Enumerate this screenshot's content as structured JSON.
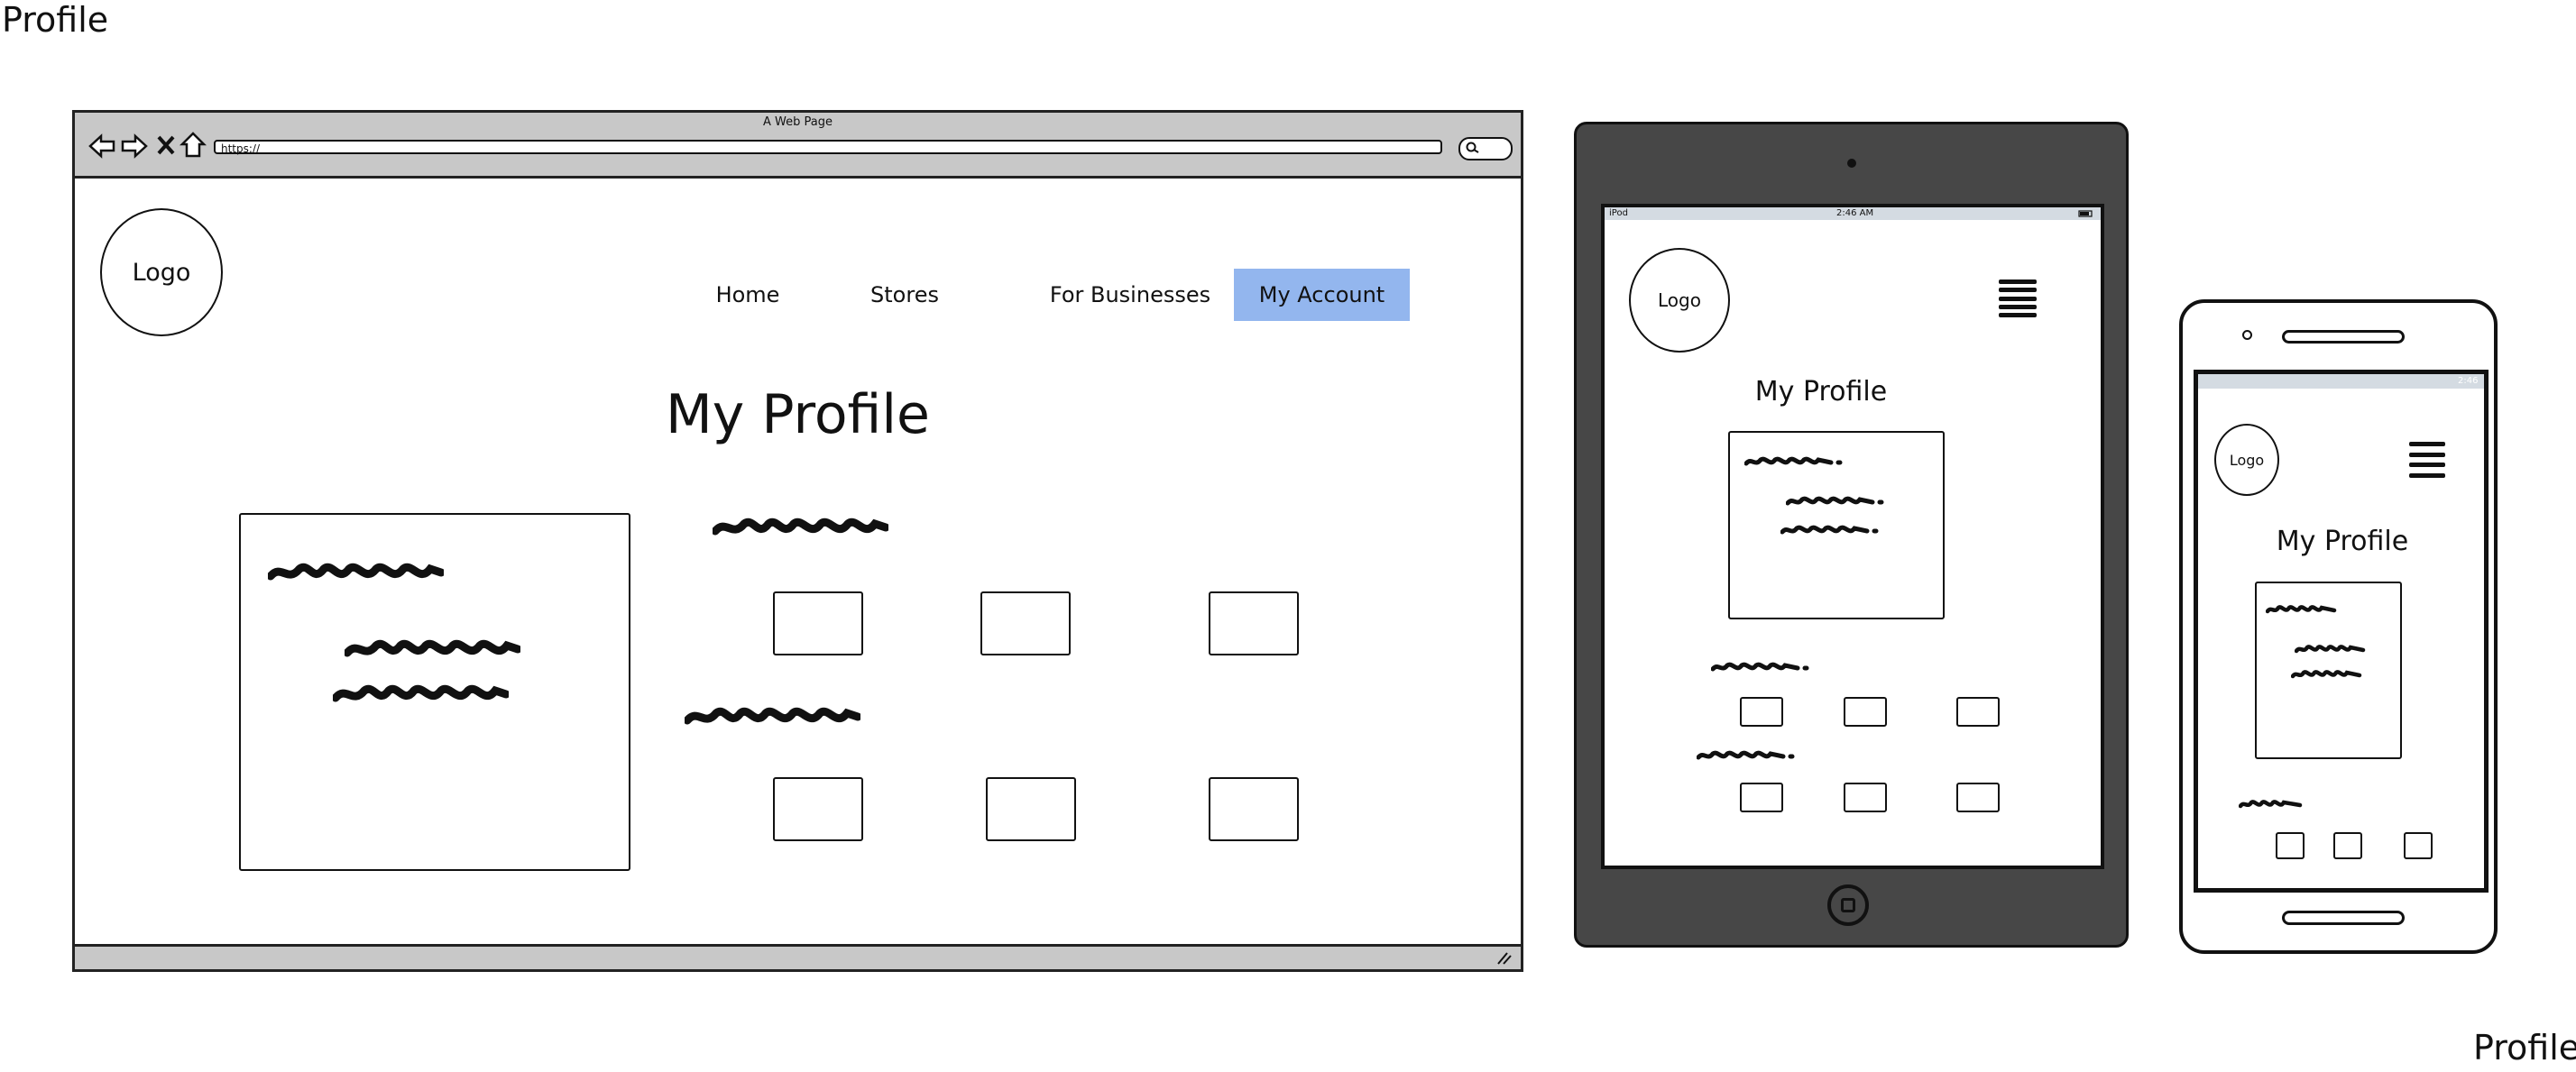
{
  "labels": {
    "top_left": "Profile",
    "bottom_right": "Profile"
  },
  "desktop": {
    "window_title": "A Web Page",
    "url": "https://",
    "logo": "Logo",
    "nav": [
      {
        "label": "Home",
        "active": false
      },
      {
        "label": "Stores",
        "active": false
      },
      {
        "label": "For Businesses",
        "active": false
      },
      {
        "label": "My Account",
        "active": true
      }
    ],
    "heading": "My Profile"
  },
  "tablet": {
    "status_left": "iPod",
    "status_time": "2:46 AM",
    "logo": "Logo",
    "heading": "My Profile"
  },
  "phone": {
    "status_time": "2:46",
    "logo": "Logo",
    "heading": "My Profile"
  },
  "colors": {
    "active_nav": "#93b6ee",
    "chrome": "#c8c8c8",
    "tablet_body": "#474747"
  }
}
